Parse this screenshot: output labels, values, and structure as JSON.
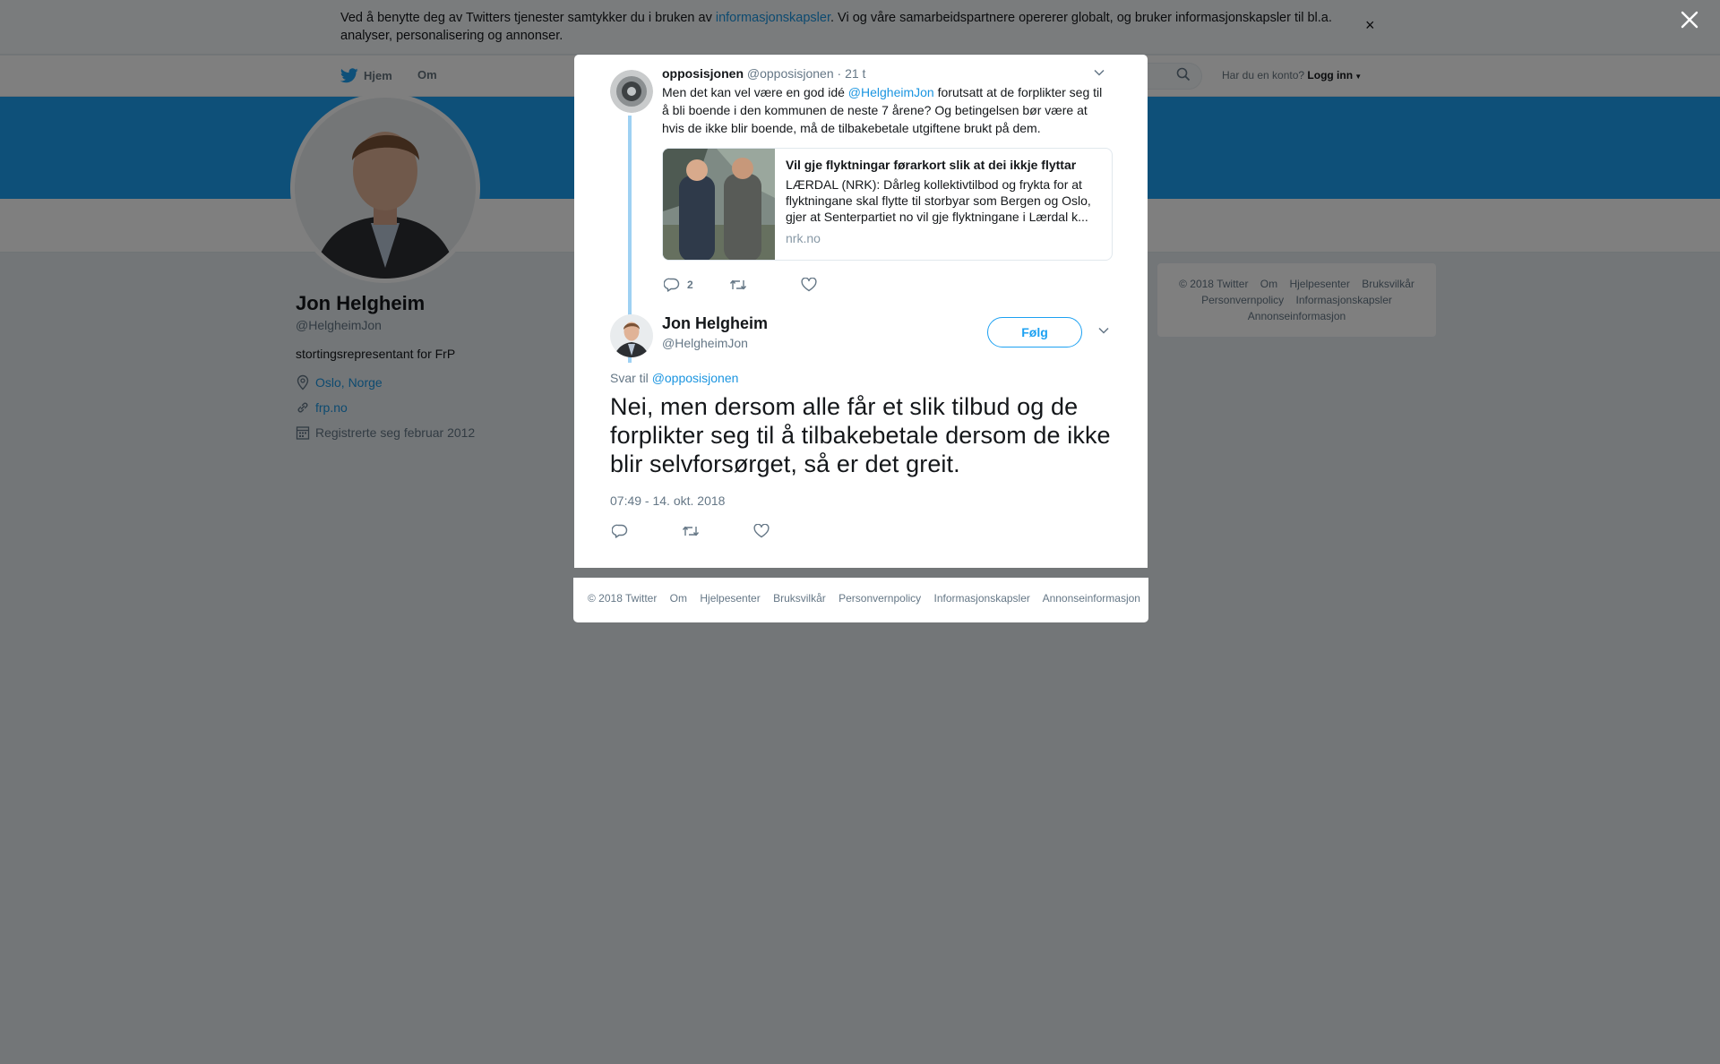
{
  "cookie_bar": {
    "text_before": "Ved å benytte deg av Twitters tjenester samtykker du i bruken av ",
    "link": "informasjonskapsler",
    "text_after": ". Vi og våre samarbeidspartnere opererer globalt, og bruker informasjonskapsler til bl.a. analyser, personalisering og annonser.",
    "close": "×"
  },
  "nav": {
    "home": "Hjem",
    "about": "Om",
    "have_account": "Har du en konto?",
    "login": "Logg inn"
  },
  "profile": {
    "name": "Jon Helgheim",
    "handle": "@HelgheimJon",
    "bio": "stortingsrepresentant for FrP",
    "location": "Oslo, Norge",
    "website": "frp.no",
    "joined": "Registrerte seg februar 2012"
  },
  "side_footer": {
    "items": [
      "© 2018 Twitter",
      "Om",
      "Hjelpesenter",
      "Bruksvilkår",
      "Personvernpolicy",
      "Informasjonskapsler",
      "Annonseinformasjon"
    ]
  },
  "parent_tweet": {
    "name": "opposisjonen",
    "handle": "@opposisjonen",
    "time": "· 21 t",
    "text_before": "Men det kan vel være en god idé ",
    "mention": "@HelgheimJon",
    "text_after": " forutsatt at de forplikter seg til å bli boende i den kommunen de neste 7 årene? Og betingelsen bør være at hvis de ikke blir boende, må de tilbakebetale utgiftene brukt på dem.",
    "card": {
      "title": "Vil gje flyktningar førarkort slik at dei ikkje flyttar",
      "description": "LÆRDAL (NRK): Dårleg kollektivtilbod og frykta for at flyktningane skal flytte til storbyar som Bergen og Oslo, gjer at Senterpartiet no vil gje flyktningane i Lærdal k...",
      "domain": "nrk.no"
    },
    "reply_count": "2"
  },
  "main_tweet": {
    "name": "Jon Helgheim",
    "handle": "@HelgheimJon",
    "follow": "Følg",
    "reply_to_label": "Svar til ",
    "reply_to_handle": "@opposisjonen",
    "text": "Nei, men dersom alle får et slik tilbud og de forplikter seg til å tilbakebetale dersom de ikke blir selvforsørget, så er det greit.",
    "timestamp": "07:49 - 14. okt. 2018"
  },
  "modal_footer": {
    "items": [
      "© 2018 Twitter",
      "Om",
      "Hjelpesenter",
      "Bruksvilkår",
      "Personvernpolicy",
      "Informasjonskapsler",
      "Annonseinformasjon"
    ]
  },
  "colors": {
    "brand_blue": "#1da1f2",
    "link_blue": "#1b95e0",
    "overlay": "rgba(0,0,0,0.5)"
  },
  "icons": [
    "twitter-bird-icon",
    "search-icon",
    "location-icon",
    "link-icon",
    "calendar-icon",
    "reply-icon",
    "retweet-icon",
    "like-icon",
    "chevron-down-icon",
    "close-icon"
  ]
}
